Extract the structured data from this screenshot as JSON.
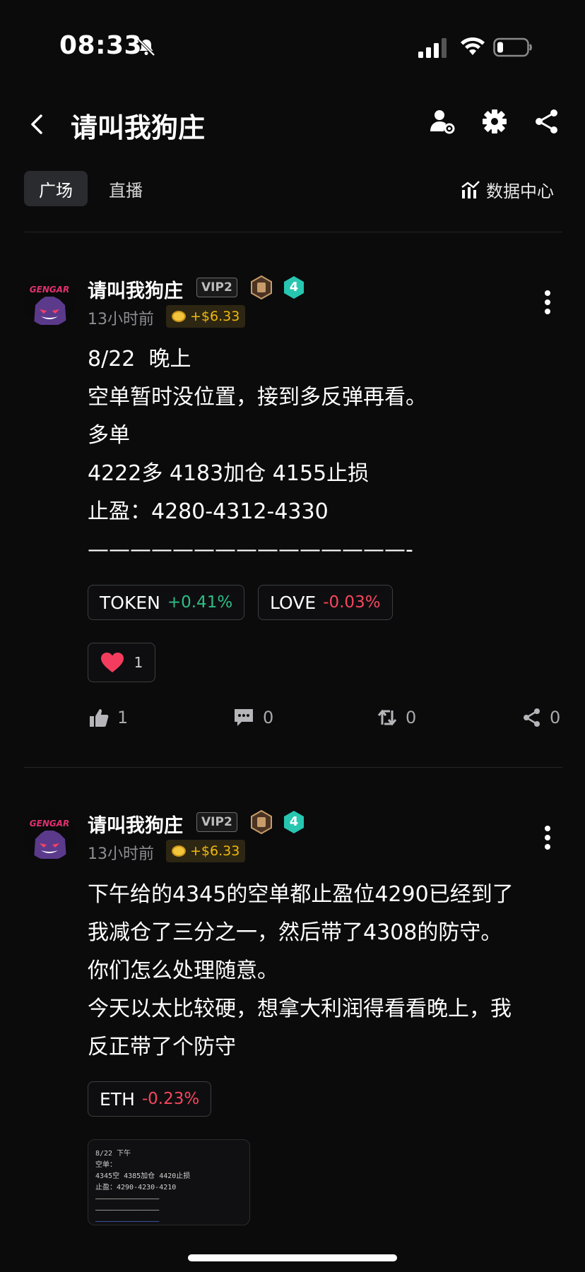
{
  "status_bar": {
    "time": "08:33"
  },
  "header": {
    "title": "请叫我狗庄"
  },
  "tabs": [
    {
      "label": "广场"
    },
    {
      "label": "直播"
    }
  ],
  "data_center": "数据中心",
  "posts": [
    {
      "username": "请叫我狗庄",
      "vip": "VIP2",
      "level": "4",
      "time": "13小时前",
      "reward": "+$6.33",
      "text": "8/22  晚上\n空单暂时没位置，接到多反弹再看。\n多单\n4222多 4183加仓 4155止损\n止盈：4280-4312-4330\n———————————————-",
      "chips": [
        {
          "symbol": "TOKEN",
          "change": "+0.41%"
        },
        {
          "symbol": "LOVE",
          "change": "-0.03%"
        }
      ],
      "reaction_count": "1",
      "likes": "1",
      "comments": "0",
      "reposts": "0",
      "shares": "0"
    },
    {
      "username": "请叫我狗庄",
      "vip": "VIP2",
      "level": "4",
      "time": "13小时前",
      "reward": "+$6.33",
      "text": "下午给的4345的空单都止盈位4290已经到了\n我减仓了三分之一，然后带了4308的防守。\n你们怎么处理随意。\n今天以太比较硬，想拿大利润得看看晚上，我\n反正带了个防守",
      "chips": [
        {
          "symbol": "ETH",
          "change": "-0.23%"
        }
      ],
      "image_lines": [
        "8/22 下午",
        "空单：",
        "4345空 4385加仓 4420止损",
        "止盈：4290-4230-4210",
        "———————————————",
        "———————————————",
        "———————————————"
      ]
    }
  ],
  "colors": {
    "up": "#2ebd85",
    "down": "#f6465d",
    "reward": "#f0b90b",
    "background": "#0b0b0c"
  }
}
